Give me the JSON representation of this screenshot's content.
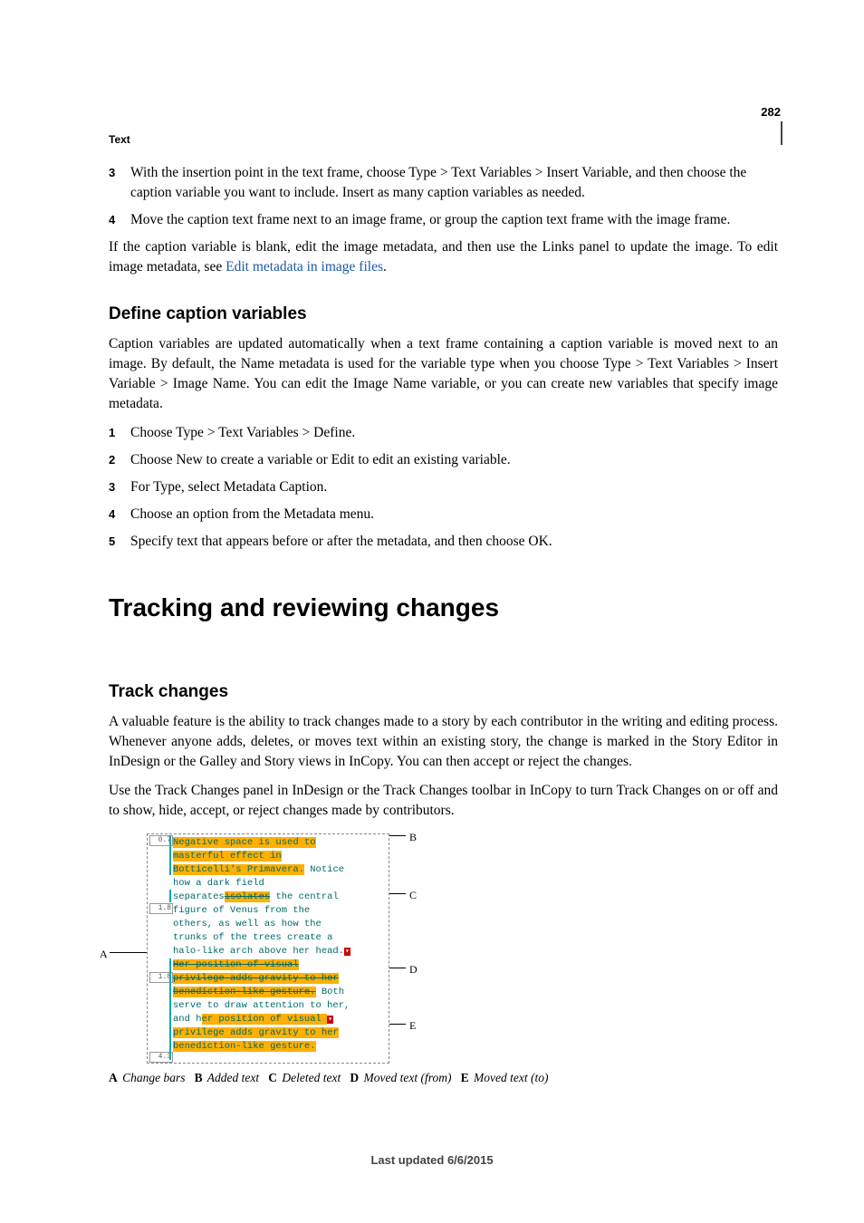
{
  "page_number": "282",
  "section_label": "Text",
  "top_list": [
    {
      "num": "3",
      "text": "With the insertion point in the text frame, choose Type > Text Variables > Insert Variable, and then choose the caption variable you want to include. Insert as many caption variables as needed."
    },
    {
      "num": "4",
      "text": "Move the caption text frame next to an image frame, or group the caption text frame with the image frame."
    }
  ],
  "para_after_top": {
    "prefix": "If the caption variable is blank, edit the image metadata, and then use the Links panel to update the image. To edit image metadata, see ",
    "link_text": "Edit metadata in image files",
    "suffix": "."
  },
  "subhead1": "Define caption variables",
  "sub1_intro": "Caption variables are updated automatically when a text frame containing a caption variable is moved next to an image. By default, the Name metadata is used for the variable type when you choose Type > Text Variables > Insert Variable > Image Name. You can edit the Image Name variable, or you can create new variables that specify image metadata.",
  "sub1_list": [
    {
      "num": "1",
      "text": "Choose Type > Text Variables > Define."
    },
    {
      "num": "2",
      "text": "Choose New to create a variable or Edit to edit an existing variable."
    },
    {
      "num": "3",
      "text": "For Type, select Metadata Caption."
    },
    {
      "num": "4",
      "text": "Choose an option from the Metadata menu."
    },
    {
      "num": "5",
      "text": "Specify text that appears before or after the metadata, and then choose OK."
    }
  ],
  "title2": "Tracking and reviewing changes",
  "subhead2": "Track changes",
  "sub2_p1": "A valuable feature is the ability to track changes made to a story by each contributor in the writing and editing process. Whenever anyone adds, deletes, or moves text within an existing story, the change is marked in the Story Editor in InDesign or the Galley and Story views in InCopy. You can then accept or reject the changes.",
  "sub2_p2": "Use the Track Changes panel in InDesign or the Track Changes toolbar in InCopy to turn Track Changes on or off and to show, hide, accept, or reject changes made by contributors.",
  "figure": {
    "story": {
      "col_labels": [
        "0.7",
        "1.8",
        "1.8",
        "4.3"
      ],
      "l1_a": "Negative space is used to ",
      "l2_a": "masterful effect in ",
      "l3_a": "Botticelli's Primavera.",
      "l3_b": " Notice",
      "l4": "how a dark field",
      "l5_a": "separates",
      "l5_del": "isolates",
      "l5_b": " the central",
      "l6": "figure of Venus from the",
      "l7": "others, as well as how the",
      "l8": "trunks of the trees create a",
      "l9": "halo-like arch above her head.",
      "l10_mf": "Her position of visual ",
      "l11_mf": "privilege adds gravity to her ",
      "l12_mf_a": "benediction-like gesture.",
      "l12_b": " Both",
      "l13": "serve to draw attention to her,",
      "l14_a": "and h",
      "l14_mt": "er position of visual ",
      "l15_mt": "privilege adds gravity to her ",
      "l16_mt": "benediction-like gesture."
    },
    "callouts": {
      "A": "A",
      "B": "B",
      "C": "C",
      "D": "D",
      "E": "E"
    },
    "legend": {
      "A": "Change bars",
      "B": "Added text",
      "C": "Deleted text",
      "D": "Moved text (from)",
      "E": "Moved text (to)"
    }
  },
  "footer": "Last updated 6/6/2015"
}
